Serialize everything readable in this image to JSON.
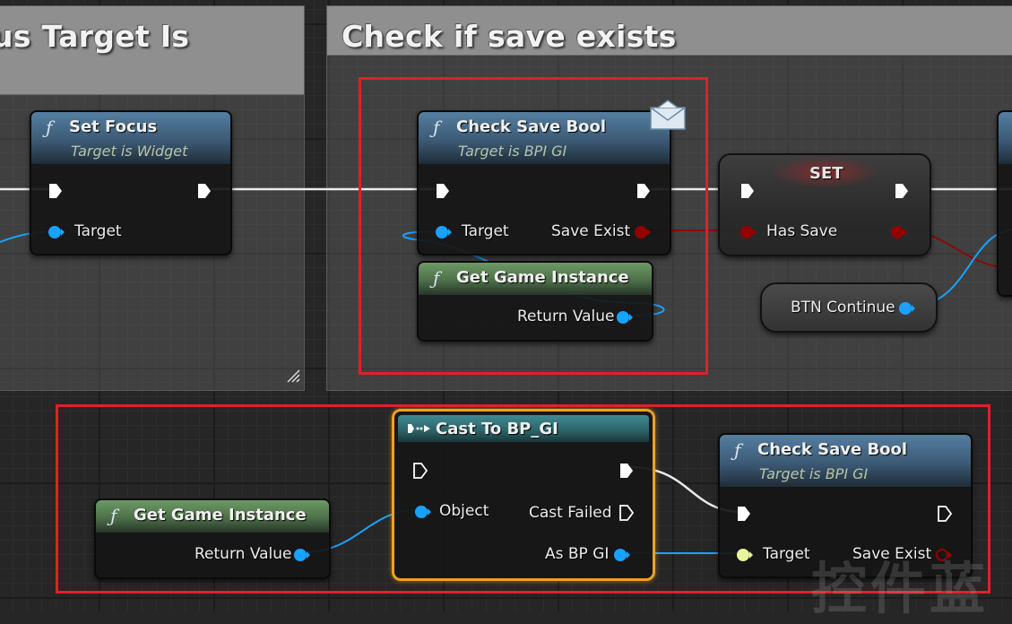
{
  "comments": {
    "left_title": "us Target Is",
    "right_title": "Check if save exists"
  },
  "nodes": {
    "set_focus": {
      "icon": "function-icon",
      "title": "Set Focus",
      "subtitle": "Target is Widget",
      "target_label": "Target"
    },
    "check_save_top": {
      "icon": "function-icon",
      "title": "Check Save Bool",
      "subtitle": "Target is BPI GI",
      "target_label": "Target",
      "save_exist_label": "Save Exist"
    },
    "get_game_instance_top": {
      "icon": "function-icon",
      "title": "Get Game Instance",
      "return_label": "Return Value"
    },
    "set_node": {
      "title": "SET",
      "has_save_label": "Has Save"
    },
    "btn_continue": {
      "label": "BTN Continue"
    },
    "get_game_instance_bottom": {
      "icon": "function-icon",
      "title": "Get Game Instance",
      "return_label": "Return Value"
    },
    "cast": {
      "icon": "cast-icon",
      "title": "Cast To BP_GI",
      "object_label": "Object",
      "cast_failed_label": "Cast Failed",
      "as_label": "As BP GI"
    },
    "check_save_bottom": {
      "icon": "function-icon",
      "title": "Check Save Bool",
      "subtitle": "Target is BPI GI",
      "target_label": "Target",
      "save_exist_label": "Save Exist"
    }
  },
  "watermark": {
    "text": "控件蓝"
  },
  "colors": {
    "object_pin": "#18a2ff",
    "bool_pin": "#940000",
    "interface_pin": "#e8f59a",
    "highlight_box": "#e0202a",
    "cast_border": "#f0a020"
  }
}
